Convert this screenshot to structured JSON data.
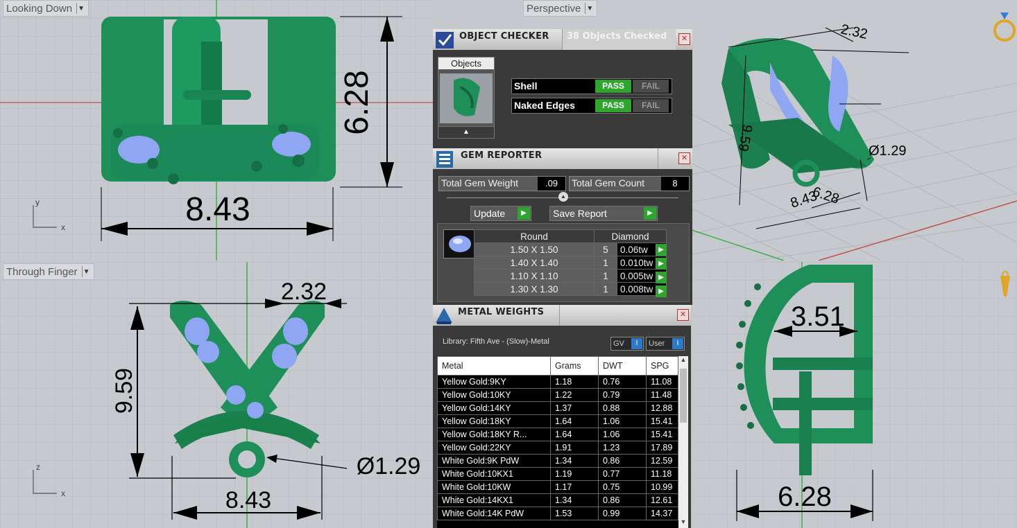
{
  "viewports": {
    "top_left": {
      "title": "Looking Down",
      "dims": [
        "6.28",
        "8.43"
      ],
      "axis_a": "y",
      "axis_b": "x"
    },
    "top_right": {
      "title": "Perspective",
      "dims": [
        "2.32",
        "9.59",
        "Ø1.29",
        "6.28",
        "8.43"
      ]
    },
    "bottom_left": {
      "title": "Through Finger",
      "dims": [
        "2.32",
        "9.59",
        "Ø1.29",
        "8.43"
      ],
      "axis_a": "z",
      "axis_b": "x"
    },
    "bottom_right": {
      "dims": [
        "3.51",
        "6.28"
      ]
    }
  },
  "object_checker": {
    "title": "OBJECT CHECKER",
    "status": "38  Objects Checked",
    "objects_label": "Objects",
    "rows": [
      {
        "label": "Shell",
        "pass": "PASS",
        "fail": "FAIL"
      },
      {
        "label": "Naked Edges",
        "pass": "PASS",
        "fail": "FAIL"
      }
    ]
  },
  "gem_reporter": {
    "title": "GEM REPORTER",
    "total_weight_label": "Total Gem Weight",
    "total_weight_value": ".09",
    "total_count_label": "Total Gem Count",
    "total_count_value": "8",
    "update_label": "Update",
    "save_label": "Save Report",
    "shape": "Round",
    "material": "Diamond",
    "gems": [
      {
        "size": "1.50 X 1.50",
        "qty": "5",
        "tw": "0.06tw"
      },
      {
        "size": "1.40 X 1.40",
        "qty": "1",
        "tw": "0.010tw"
      },
      {
        "size": "1.10 X 1.10",
        "qty": "1",
        "tw": "0.005tw"
      },
      {
        "size": "1.30 X 1.30",
        "qty": "1",
        "tw": "0.008tw"
      }
    ]
  },
  "metal_weights": {
    "title": "METAL WEIGHTS",
    "library": "Library: Fifth Ave - (Slow)-Metal",
    "gv_label": "GV",
    "user_label": "User",
    "headers": [
      "Metal",
      "Grams",
      "DWT",
      "SPG"
    ],
    "rows": [
      [
        "Yellow Gold:9KY",
        "1.18",
        "0.76",
        "11.08"
      ],
      [
        "Yellow Gold:10KY",
        "1.22",
        "0.79",
        "11.48"
      ],
      [
        "Yellow Gold:14KY",
        "1.37",
        "0.88",
        "12.88"
      ],
      [
        "Yellow Gold:18KY",
        "1.64",
        "1.06",
        "15.41"
      ],
      [
        "Yellow Gold:18KY R...",
        "1.64",
        "1.06",
        "15.41"
      ],
      [
        "Yellow Gold:22KY",
        "1.91",
        "1.23",
        "17.89"
      ],
      [
        "White Gold:9K PdW",
        "1.34",
        "0.86",
        "12.59"
      ],
      [
        "White Gold:10KX1",
        "1.19",
        "0.77",
        "11.18"
      ],
      [
        "White Gold:10KW",
        "1.17",
        "0.75",
        "10.99"
      ],
      [
        "White Gold:14KX1",
        "1.34",
        "0.86",
        "12.61"
      ],
      [
        "White Gold:14K PdW",
        "1.53",
        "0.99",
        "14.37"
      ]
    ]
  },
  "colors": {
    "model_green": "#1f8f5a",
    "gem_blue": "#8fa6f2",
    "pass_green": "#2ea62e",
    "grid_line": "#b4b7bb"
  }
}
